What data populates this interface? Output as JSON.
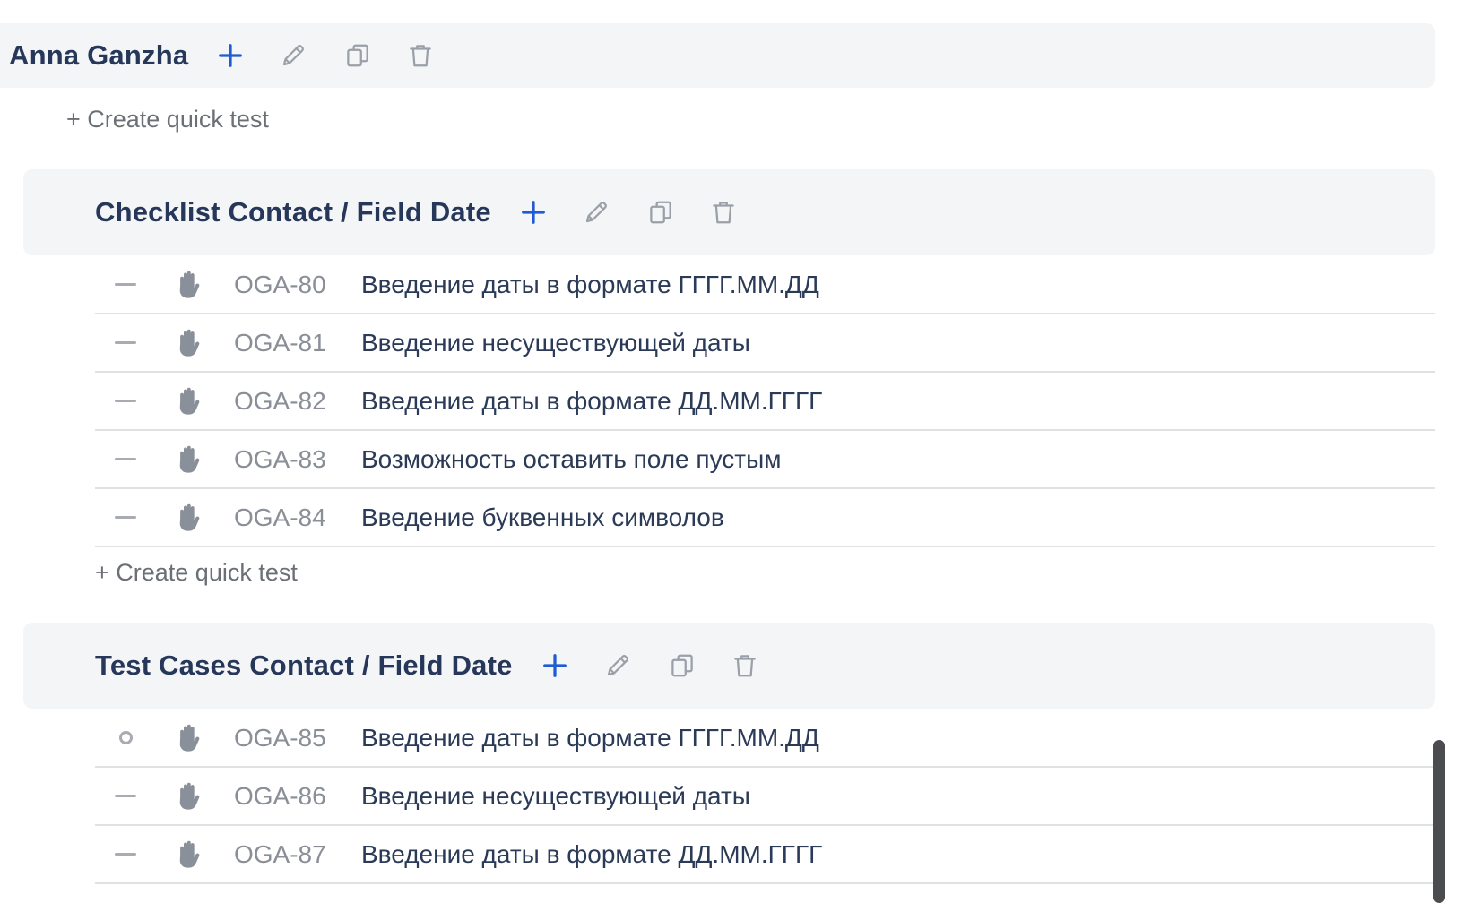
{
  "colors": {
    "accent": "#1f5bd1",
    "muted_icon": "#9aa0a8",
    "header_bg": "#f4f5f7"
  },
  "top_folder": {
    "title": "Anna Ganzha",
    "quick_test_label": "+ Create quick test"
  },
  "folders": [
    {
      "title": "Checklist Contact / Field Date",
      "cases": [
        {
          "key": "OGA-80",
          "title": "Введение даты в формате ГГГГ.ММ.ДД",
          "status_icon": "dash"
        },
        {
          "key": "OGA-81",
          "title": "Введение несуществующей даты",
          "status_icon": "dash"
        },
        {
          "key": "OGA-82",
          "title": "Введение даты в формате ДД.ММ.ГГГГ",
          "status_icon": "dash"
        },
        {
          "key": "OGA-83",
          "title": "Возможность оставить поле пустым",
          "status_icon": "dash"
        },
        {
          "key": "OGA-84",
          "title": "Введение буквенных символов",
          "status_icon": "dash"
        }
      ],
      "quick_test_label": "+ Create quick test"
    },
    {
      "title": "Test Cases Contact / Field Date",
      "cases": [
        {
          "key": "OGA-85",
          "title": "Введение даты в формате ГГГГ.ММ.ДД",
          "status_icon": "circle"
        },
        {
          "key": "OGA-86",
          "title": "Введение несуществующей даты",
          "status_icon": "dash"
        },
        {
          "key": "OGA-87",
          "title": "Введение даты в формате ДД.ММ.ГГГГ",
          "status_icon": "dash"
        }
      ]
    }
  ],
  "icons": {
    "add": "plus-icon",
    "edit": "pencil-icon",
    "copy": "copy-icon",
    "delete": "trash-icon",
    "manual": "hand-icon"
  }
}
